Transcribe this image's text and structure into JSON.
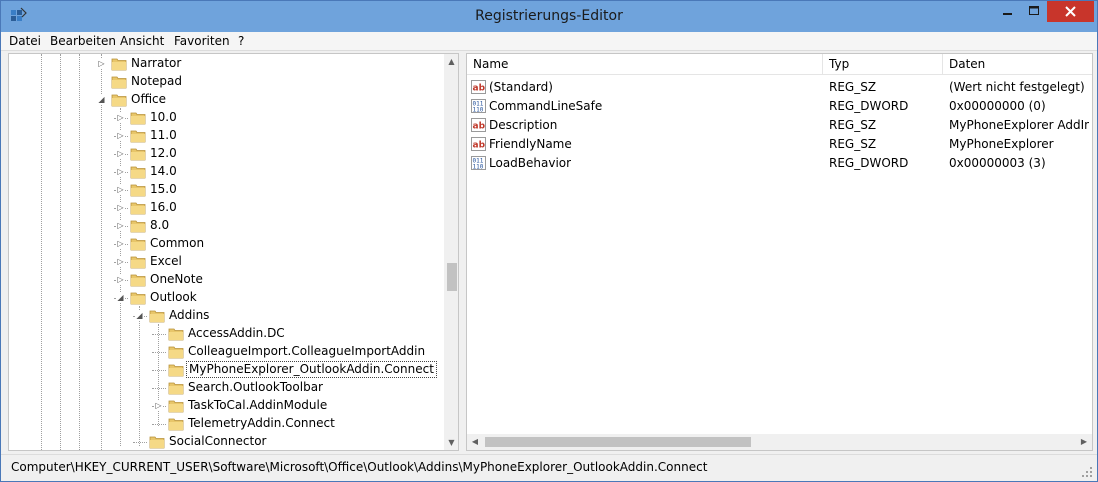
{
  "window": {
    "title": "Registrierungs-Editor",
    "accent": "#6fa3dc",
    "close_color": "#c8352b"
  },
  "menu": [
    {
      "label": "Datei"
    },
    {
      "label": "Bearbeiten"
    },
    {
      "label": "Ansicht"
    },
    {
      "label": "Favoriten"
    },
    {
      "label": "?"
    }
  ],
  "tree": {
    "items": [
      {
        "label": "Narrator",
        "depth": 0,
        "expander": "collapsed"
      },
      {
        "label": "Notepad",
        "depth": 0,
        "expander": "none"
      },
      {
        "label": "Office",
        "depth": 0,
        "expander": "expanded"
      },
      {
        "label": "10.0",
        "depth": 1,
        "expander": "collapsed"
      },
      {
        "label": "11.0",
        "depth": 1,
        "expander": "collapsed"
      },
      {
        "label": "12.0",
        "depth": 1,
        "expander": "collapsed"
      },
      {
        "label": "14.0",
        "depth": 1,
        "expander": "collapsed"
      },
      {
        "label": "15.0",
        "depth": 1,
        "expander": "collapsed"
      },
      {
        "label": "16.0",
        "depth": 1,
        "expander": "collapsed"
      },
      {
        "label": "8.0",
        "depth": 1,
        "expander": "collapsed"
      },
      {
        "label": "Common",
        "depth": 1,
        "expander": "collapsed"
      },
      {
        "label": "Excel",
        "depth": 1,
        "expander": "collapsed"
      },
      {
        "label": "OneNote",
        "depth": 1,
        "expander": "collapsed"
      },
      {
        "label": "Outlook",
        "depth": 1,
        "expander": "expanded"
      },
      {
        "label": "Addins",
        "depth": 2,
        "expander": "expanded"
      },
      {
        "label": "AccessAddin.DC",
        "depth": 3,
        "expander": "none"
      },
      {
        "label": "ColleagueImport.ColleagueImportAddin",
        "depth": 3,
        "expander": "none"
      },
      {
        "label": "MyPhoneExplorer_OutlookAddin.Connect",
        "depth": 3,
        "expander": "none",
        "selected": true
      },
      {
        "label": "Search.OutlookToolbar",
        "depth": 3,
        "expander": "none"
      },
      {
        "label": "TaskToCal.AddinModule",
        "depth": 3,
        "expander": "collapsed"
      },
      {
        "label": "TelemetryAddin.Connect",
        "depth": 3,
        "expander": "none"
      },
      {
        "label": "SocialConnector",
        "depth": 2,
        "expander": "none"
      }
    ]
  },
  "values": {
    "columns": {
      "name": "Name",
      "type": "Typ",
      "data": "Daten"
    },
    "rows": [
      {
        "icon": "string-value-icon",
        "name": "(Standard)",
        "type": "REG_SZ",
        "data": "(Wert nicht festgelegt)"
      },
      {
        "icon": "binary-value-icon",
        "name": "CommandLineSafe",
        "type": "REG_DWORD",
        "data": "0x00000000 (0)"
      },
      {
        "icon": "string-value-icon",
        "name": "Description",
        "type": "REG_SZ",
        "data": "MyPhoneExplorer AddIn"
      },
      {
        "icon": "string-value-icon",
        "name": "FriendlyName",
        "type": "REG_SZ",
        "data": "MyPhoneExplorer"
      },
      {
        "icon": "binary-value-icon",
        "name": "LoadBehavior",
        "type": "REG_DWORD",
        "data": "0x00000003 (3)"
      }
    ]
  },
  "status": {
    "path": "Computer\\HKEY_CURRENT_USER\\Software\\Microsoft\\Office\\Outlook\\Addins\\MyPhoneExplorer_OutlookAddin.Connect"
  }
}
